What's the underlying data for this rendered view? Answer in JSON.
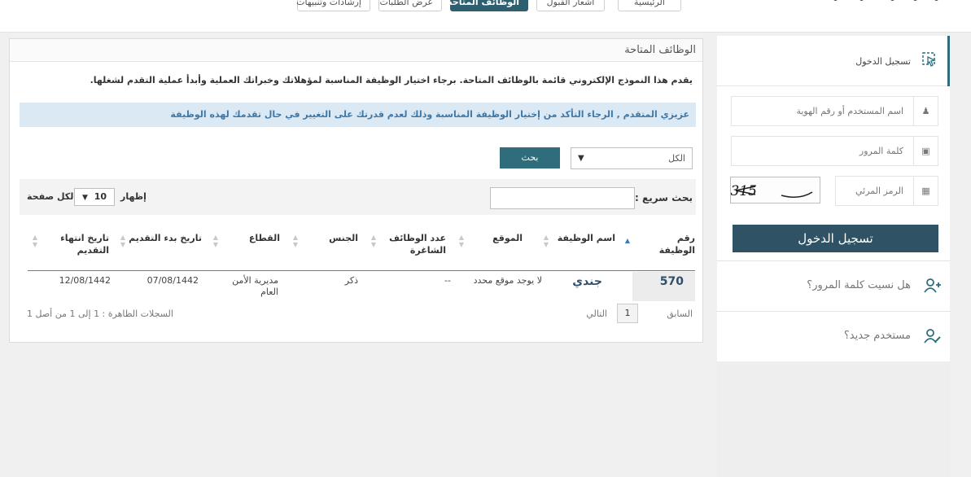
{
  "nav": {
    "items": [
      {
        "label": "الرئيسية"
      },
      {
        "label": "اشعار القبول"
      },
      {
        "label": "الوظائف المتاحة",
        "active": true
      },
      {
        "label": "عرض الطلبات"
      },
      {
        "label": "إرشادات وتنبيهات"
      }
    ]
  },
  "panel": {
    "title": "الوظائف المتاحة",
    "intro": "يقدم هذا النموذج الإلكتروني قائمة بالوظائف المتاحة. برجاء اختيار الوظيفة المناسبة لمؤهلاتك وخبراتك العملية وأبدأ عملية التقدم لشغلها.",
    "alert": "عزيزي المتقدم , الرجاء التأكد من إختيار الوظيفة المناسبة وذلك لعدم قدرتك على التغيير في حال تقدمك لهذه الوظيفة"
  },
  "filter": {
    "selected": "الكل",
    "search_button": "بحث"
  },
  "datatable": {
    "quick_search_label": "بحث سريع :",
    "show_label": "إظهار",
    "page_size": "10",
    "per_page_label": "لكل صفحة",
    "columns": [
      "رقم الوظيفة",
      "اسم الوظيفة",
      "الموقع",
      "عدد الوظائف الشاغرة",
      "الجنس",
      "القطاع",
      "تاريخ بدء التقديم",
      "تاريخ انتهاء التقديم"
    ],
    "rows": [
      {
        "job_no": "570",
        "job_name": "جندي",
        "location": "لا يوجد موقع محدد",
        "vacancies": "--",
        "gender": "ذكر",
        "sector": "مديرية الأمن العام",
        "start_date": "07/08/1442",
        "end_date": "12/08/1442"
      }
    ],
    "pager": {
      "prev": "السابق",
      "current": "1",
      "next": "التالي",
      "info": "السجلات الظاهرة : 1 إلى 1 من أصل 1"
    }
  },
  "sidebar": {
    "login_title": "تسجيل الدخول",
    "username_placeholder": "اسم المستخدم أو رقم الهوية",
    "password_placeholder": "كلمة المرور",
    "captcha_placeholder": "الرمز المرئي",
    "captcha_text": "7315",
    "login_button": "تسجيل الدخول",
    "forgot_password": "هل نسيت كلمة المرور؟",
    "new_user": "مستخدم جديد؟"
  },
  "icons": {
    "login": "cursor-box-icon",
    "user": "user-icon",
    "lock": "lock-icon",
    "captcha": "image-icon",
    "forgot": "user-add-icon",
    "new_user": "user-edit-icon"
  },
  "colors": {
    "accent": "#2f6d7d",
    "login_button": "#2f5365",
    "alert_bg": "#dbe9f5",
    "alert_text": "#3f78a6"
  }
}
